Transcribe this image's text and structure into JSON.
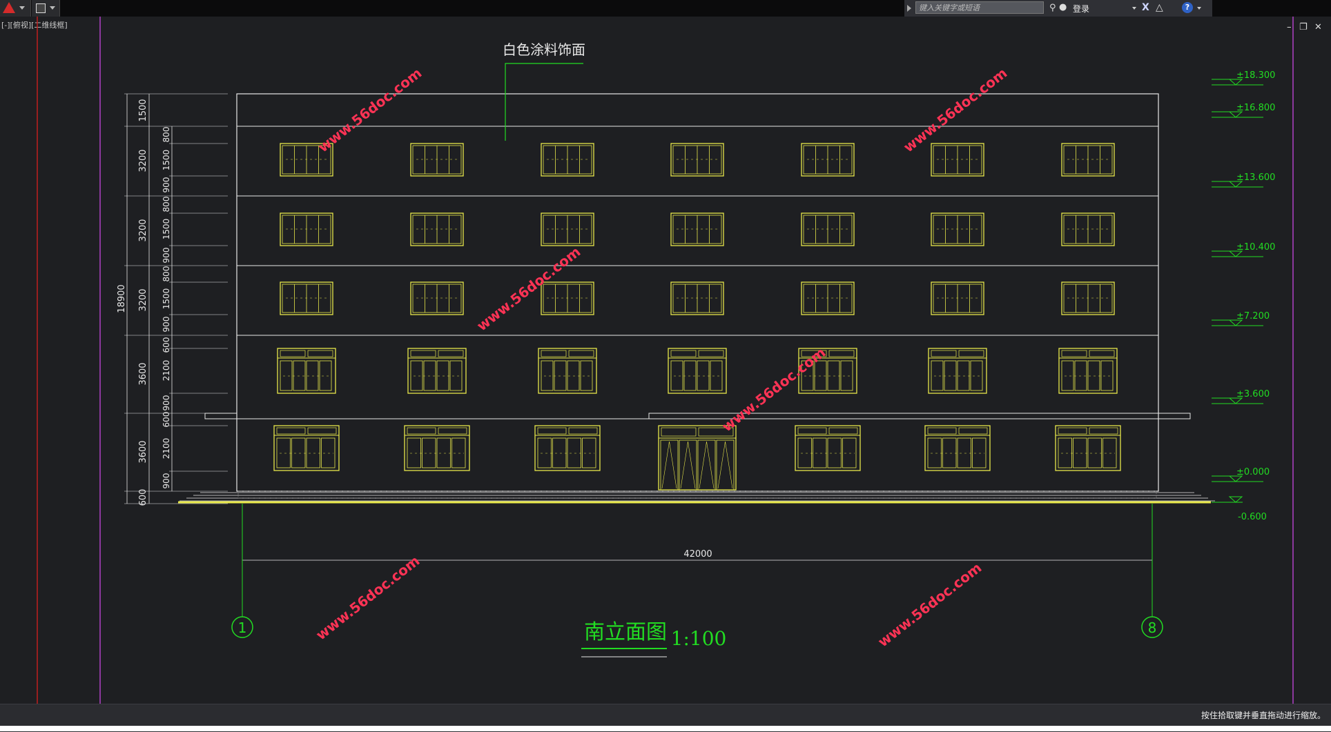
{
  "app": {
    "search_placeholder": "键入关键字或短语",
    "login_label": "登录",
    "viewport_label": "[-][俯视][二维线框]",
    "status_text": "按住拾取键并垂直拖动进行缩放。"
  },
  "drawing": {
    "note": "白色涂料饰面",
    "title": "南立面图",
    "scale": "1:100",
    "overall_width": "42000",
    "axis_left": "1",
    "axis_right": "8",
    "watermark": "www.56doc.com",
    "total_height": "18900",
    "floor_heights": [
      "1500",
      "3200",
      "3200",
      "3200",
      "3600",
      "3600",
      "600"
    ],
    "detail_dims": [
      "800",
      "1500",
      "900",
      "800",
      "1500",
      "900",
      "800",
      "1500",
      "900",
      "600",
      "2100",
      "900",
      "600",
      "2100",
      "900"
    ],
    "elevations": [
      "±18.300",
      "±16.800",
      "±13.600",
      "±10.400",
      "±7.200",
      "±3.600",
      "±0.000",
      "-0.600"
    ]
  },
  "colors": {
    "line_white": "#e8e8e8",
    "window_yellow": "#e8e84a",
    "annotation_green": "#22dd22",
    "watermark_red": "#ff3355",
    "magenta_guide": "#b040c8",
    "red_guide": "#c01e1e"
  }
}
